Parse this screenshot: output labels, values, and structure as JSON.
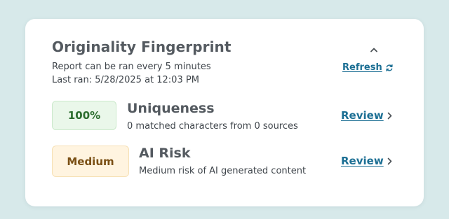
{
  "card": {
    "title": "Originality Fingerprint",
    "collapse_icon": "chevron-up-icon",
    "schedule_text": "Report can be ran every 5 minutes",
    "last_ran_text": "Last ran: 5/28/2025 at 12:03 PM",
    "refresh_label": "Refresh",
    "refresh_icon": "refresh-icon"
  },
  "metrics": [
    {
      "badge": "100%",
      "badge_color": "#eaf7ea",
      "badge_text_color": "#2c6d2e",
      "name": "Uniqueness",
      "description": "0 matched characters from 0 sources",
      "action_label": "Review",
      "action_icon": "chevron-right-icon"
    },
    {
      "badge": "Medium",
      "badge_color": "#fff4e0",
      "badge_text_color": "#7a4f14",
      "name": "AI Risk",
      "description": "Medium risk of AI generated content",
      "action_label": "Review",
      "action_icon": "chevron-right-icon"
    }
  ],
  "colors": {
    "background": "#d7e9ea",
    "card": "#ffffff",
    "link": "#1c6f94",
    "heading": "#545a60"
  }
}
